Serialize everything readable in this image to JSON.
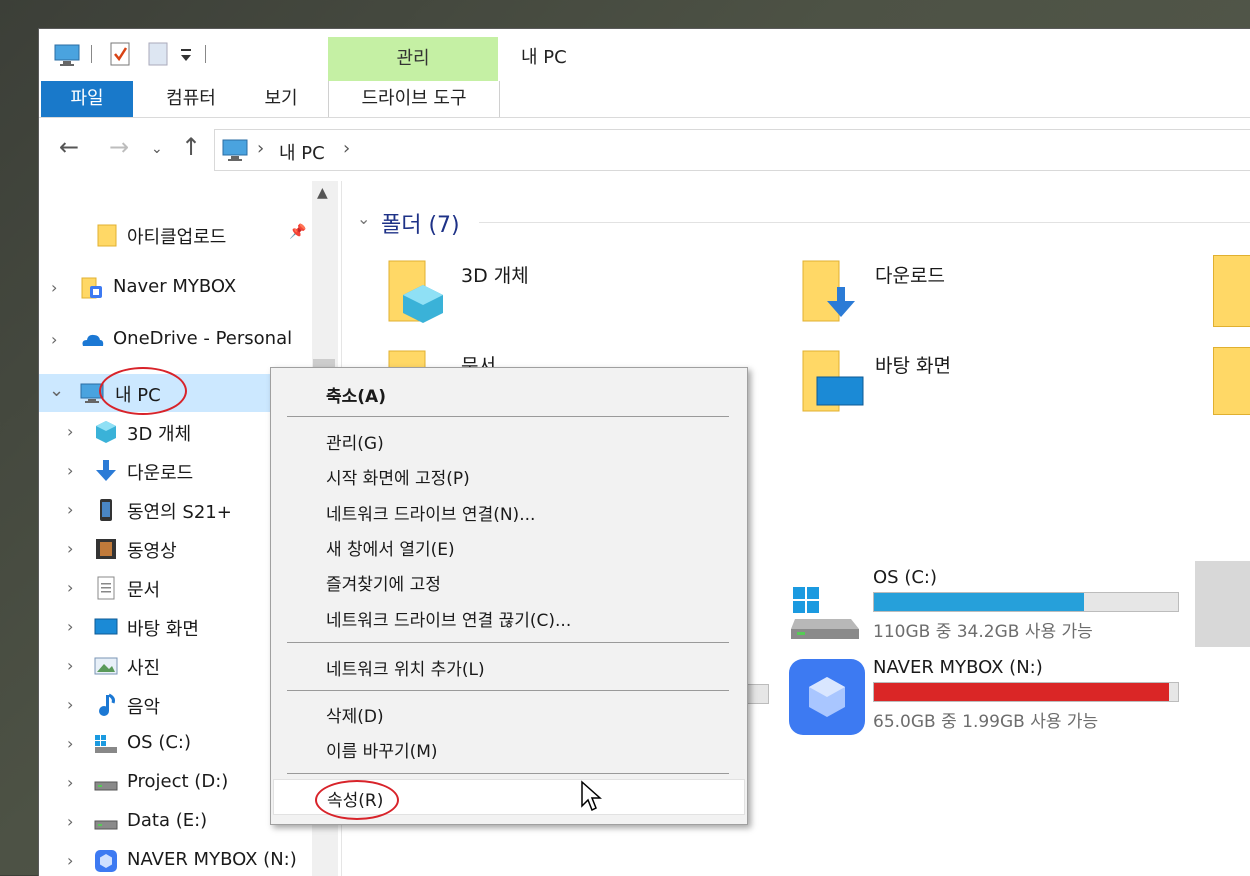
{
  "window": {
    "title": "내 PC",
    "context_tab_group": "관리"
  },
  "ribbon": {
    "tabs": [
      "파일",
      "컴퓨터",
      "보기",
      "드라이브 도구"
    ]
  },
  "address": {
    "path": [
      "내 PC"
    ]
  },
  "nav_pane": {
    "items": [
      {
        "label": "아티클업로드",
        "icon": "folder-icon",
        "pinned": true
      },
      {
        "label": "Naver MYBOX",
        "icon": "mybox-folder-icon"
      },
      {
        "label": "OneDrive - Personal",
        "icon": "cloud-icon"
      },
      {
        "label": "내 PC",
        "icon": "computer-icon",
        "selected": true,
        "expanded": true
      },
      {
        "label": "3D 개체",
        "icon": "cube-icon"
      },
      {
        "label": "다운로드",
        "icon": "download-icon"
      },
      {
        "label": "동연의 S21+",
        "icon": "phone-icon"
      },
      {
        "label": "동영상",
        "icon": "video-icon"
      },
      {
        "label": "문서",
        "icon": "document-icon"
      },
      {
        "label": "바탕 화면",
        "icon": "desktop-icon"
      },
      {
        "label": "사진",
        "icon": "picture-icon"
      },
      {
        "label": "음악",
        "icon": "music-icon"
      },
      {
        "label": "OS (C:)",
        "icon": "windows-drive-icon"
      },
      {
        "label": "Project (D:)",
        "icon": "drive-icon"
      },
      {
        "label": "Data (E:)",
        "icon": "drive-icon"
      },
      {
        "label": "NAVER MYBOX (N:)",
        "icon": "mybox-icon"
      }
    ]
  },
  "content": {
    "folders_header": "폴더 (7)",
    "folders": [
      {
        "label": "3D 개체",
        "icon": "cube-icon"
      },
      {
        "label": "다운로드",
        "icon": "download-icon"
      },
      {
        "label": "문서",
        "icon": "document-icon"
      },
      {
        "label": "바탕 화면",
        "icon": "desktop-icon"
      }
    ],
    "drives": [
      {
        "name": "OS (C:)",
        "free_text": "110GB 중 34.2GB 사용 가능",
        "used_fraction": 0.69,
        "bar_color": "#26a0da"
      },
      {
        "name": "NAVER MYBOX (N:)",
        "free_text": "65.0GB 중 1.99GB 사용 가능",
        "used_fraction": 0.97,
        "bar_color": "#da2626"
      }
    ]
  },
  "context_menu": {
    "items": [
      {
        "label": "축소(A)",
        "bold": true
      },
      {
        "label": "관리(G)"
      },
      {
        "label": "시작 화면에 고정(P)"
      },
      {
        "label": "네트워크 드라이브 연결(N)..."
      },
      {
        "label": "새 창에서 열기(E)"
      },
      {
        "label": "즐겨찾기에 고정"
      },
      {
        "label": "네트워크 드라이브 연결 끊기(C)..."
      },
      {
        "label": "네트워크 위치 추가(L)"
      },
      {
        "label": "삭제(D)"
      },
      {
        "label": "이름 바꾸기(M)"
      },
      {
        "label": "속성(R)",
        "hovered": true
      }
    ]
  },
  "colors": {
    "file_tab": "#1979ca",
    "context_tab": "#c5f0a4",
    "selection": "#cce8ff",
    "highlight_circle": "#d8232a"
  }
}
